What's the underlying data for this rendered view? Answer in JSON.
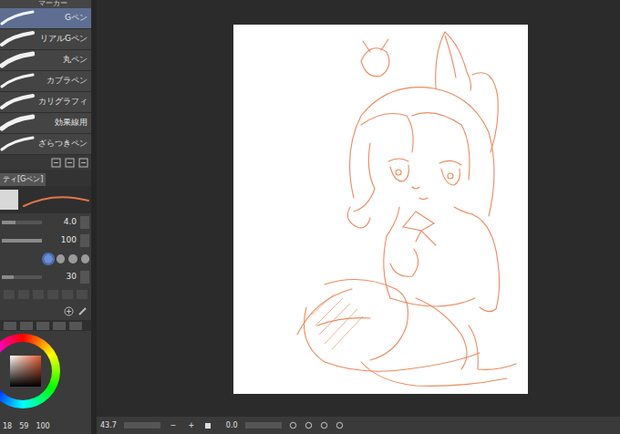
{
  "tool_tab": {
    "label": "マーカー"
  },
  "brushes": [
    {
      "label": "Gペン",
      "selected": true
    },
    {
      "label": "リアルGペン",
      "selected": false
    },
    {
      "label": "丸ペン",
      "selected": false
    },
    {
      "label": "カブラペン",
      "selected": false
    },
    {
      "label": "カリグラフィ",
      "selected": false
    },
    {
      "label": "効果線用",
      "selected": false
    },
    {
      "label": "ざらつきペン",
      "selected": false
    }
  ],
  "property_tab": {
    "label": "ティ[Gペン]"
  },
  "properties": [
    {
      "reading": "4.0",
      "level": 0.35
    },
    {
      "reading": "100",
      "level": 1.0
    },
    {
      "reading": "30",
      "level": 0.3
    }
  ],
  "color_readout": [
    "18",
    "59",
    "100"
  ],
  "status_bar": {
    "zoom": "43.7",
    "zoom_buttons": [
      "−",
      "+"
    ],
    "angle": "0.0"
  }
}
